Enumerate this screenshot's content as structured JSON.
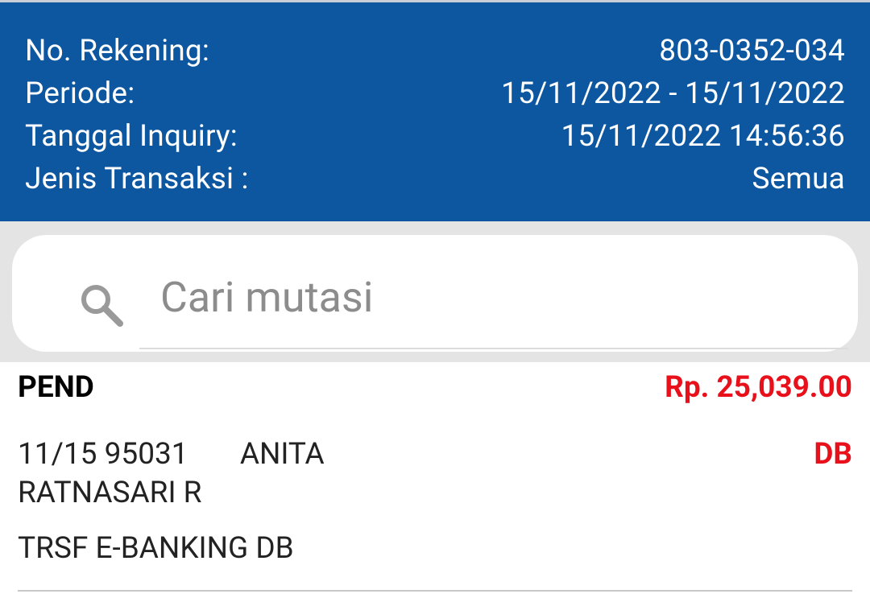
{
  "header": {
    "rows": [
      {
        "label": "No. Rekening:",
        "value": "803-0352-034"
      },
      {
        "label": "Periode:",
        "value": "15/11/2022 - 15/11/2022"
      },
      {
        "label": "Tanggal Inquiry:",
        "value": "15/11/2022 14:56:36"
      },
      {
        "label": "Jenis Transaksi :",
        "value": "Semua"
      }
    ]
  },
  "search": {
    "placeholder": "Cari mutasi",
    "value": "",
    "icon": "search-icon"
  },
  "transactions": [
    {
      "status": "PEND",
      "amount": "Rp. 25,039.00",
      "description": "11/15 95031       ANITA\nRATNASARI R",
      "type": "DB",
      "remark": "TRSF E-BANKING DB"
    }
  ],
  "colors": {
    "header_bg": "#0d56a0",
    "accent_red": "#e8101a",
    "search_band": "#e4e4e4"
  }
}
